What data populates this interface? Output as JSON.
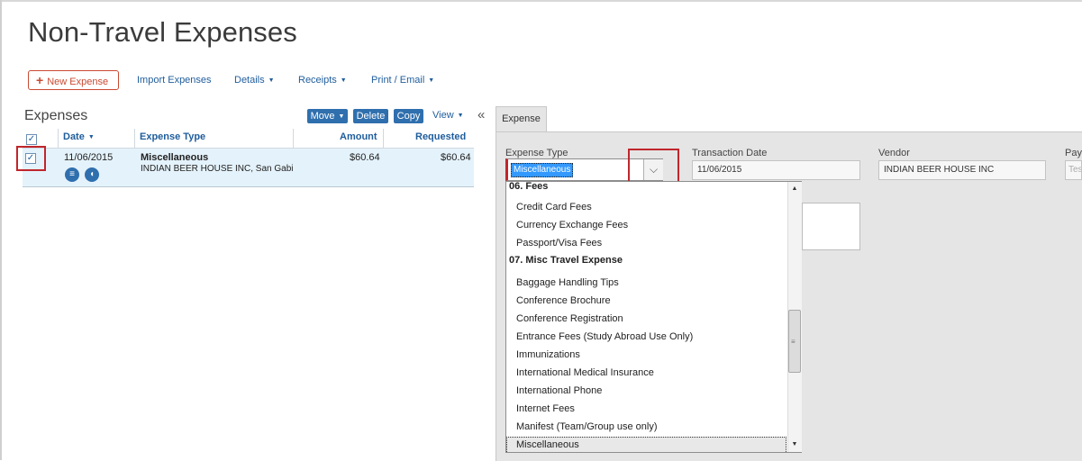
{
  "page": {
    "title": "Non-Travel Expenses"
  },
  "toolbar": {
    "new_expense": "New Expense",
    "import_expenses": "Import Expenses",
    "details": "Details",
    "receipts": "Receipts",
    "print_email": "Print / Email"
  },
  "expenses_panel": {
    "title": "Expenses",
    "actions": {
      "move": "Move",
      "delete": "Delete",
      "copy": "Copy",
      "view": "View"
    },
    "columns": {
      "date": "Date",
      "expense_type": "Expense Type",
      "amount": "Amount",
      "requested": "Requested"
    },
    "rows": [
      {
        "date": "11/06/2015",
        "expense_type": "Miscellaneous",
        "vendor_line": "INDIAN BEER HOUSE INC, San Gabi",
        "amount": "$60.64",
        "requested": "$60.64"
      }
    ]
  },
  "detail": {
    "tab": "Expense",
    "expense_type_label": "Expense Type",
    "expense_type_value": "Miscellaneous",
    "transaction_date_label": "Transaction Date",
    "transaction_date_value": "11/06/2015",
    "vendor_label": "Vendor",
    "vendor_value": "INDIAN BEER HOUSE INC",
    "pay_label": "Pay",
    "pay_value": "Tes"
  },
  "dropdown": {
    "items": [
      {
        "label": "06. Fees",
        "group": true
      },
      {
        "label": "Credit Card Fees"
      },
      {
        "label": "Currency Exchange Fees"
      },
      {
        "label": "Passport/Visa Fees"
      },
      {
        "label": "07. Misc Travel Expense",
        "group": true
      },
      {
        "label": "Baggage Handling Tips"
      },
      {
        "label": "Conference Brochure"
      },
      {
        "label": "Conference Registration"
      },
      {
        "label": "Entrance Fees (Study Abroad Use Only)"
      },
      {
        "label": "Immunizations"
      },
      {
        "label": "International Medical Insurance"
      },
      {
        "label": "International Phone"
      },
      {
        "label": "Internet Fees"
      },
      {
        "label": "Manifest (Team/Group use only)"
      },
      {
        "label": "Miscellaneous",
        "selected": true
      }
    ]
  },
  "colors": {
    "accent": "#2f6fae",
    "link": "#1f5d9c",
    "highlight_red": "#c0262c",
    "new_button": "#c94a32"
  }
}
